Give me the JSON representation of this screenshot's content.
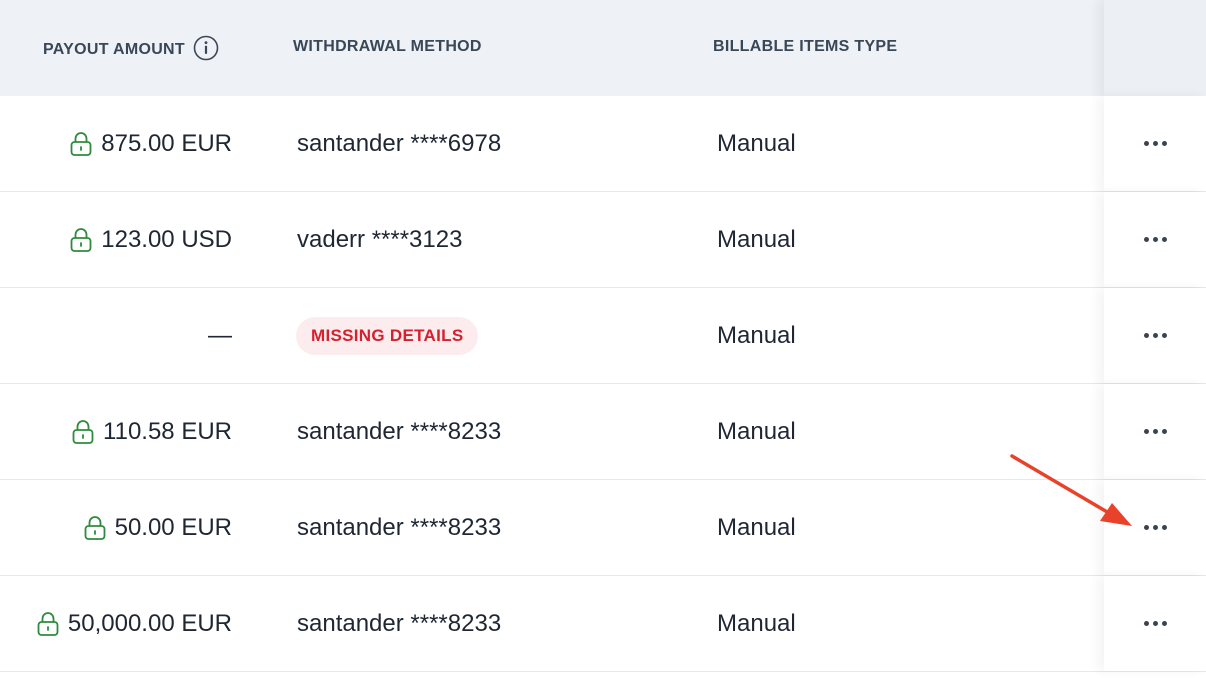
{
  "header": {
    "payout_amount": "PAYOUT AMOUNT",
    "withdrawal_method": "WITHDRAWAL METHOD",
    "billable_items_type": "BILLABLE ITEMS TYPE"
  },
  "colors": {
    "header_bg": "#eef1f6",
    "lock_icon": "#2e8b3e",
    "missing_badge_text": "#d5202e",
    "missing_badge_bg": "#fdecee",
    "annotation_arrow": "#e8432a"
  },
  "icons": {
    "header_info": "info-icon",
    "amount_lock": "lock-icon",
    "row_actions": "more-horizontal-icon"
  },
  "rows": [
    {
      "amount": "875.00 EUR",
      "locked": true,
      "method": "santander ****6978",
      "billable": "Manual"
    },
    {
      "amount": "123.00 USD",
      "locked": true,
      "method": "vaderr ****3123",
      "billable": "Manual"
    },
    {
      "amount": "—",
      "locked": false,
      "method_badge": "MISSING DETAILS",
      "billable": "Manual"
    },
    {
      "amount": "110.58 EUR",
      "locked": true,
      "method": "santander ****8233",
      "billable": "Manual"
    },
    {
      "amount": "50.00 EUR",
      "locked": true,
      "method": "santander ****8233",
      "billable": "Manual"
    },
    {
      "amount": "50,000.00 EUR",
      "locked": true,
      "method": "santander ****8233",
      "billable": "Manual"
    }
  ]
}
